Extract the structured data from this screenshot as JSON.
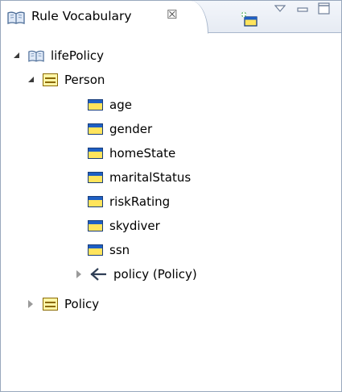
{
  "view": {
    "tab_title": "Rule Vocabulary",
    "tab_close_glyph": "☒",
    "tab_icon": "book-icon",
    "toolbar": {
      "new_icon": "new-vocabulary-icon",
      "menu_icon": "view-menu-icon",
      "minimize_icon": "minimize-icon",
      "maximize_icon": "maximize-icon"
    }
  },
  "tree": {
    "root": {
      "label": "lifePolicy",
      "icon": "book-icon",
      "expanded": true
    },
    "person": {
      "label": "Person",
      "icon": "entity-icon",
      "expanded": true,
      "attributes": [
        "age",
        "gender",
        "homeState",
        "maritalStatus",
        "riskRating",
        "skydiver",
        "ssn"
      ],
      "association": {
        "label": "policy (Policy)",
        "icon": "association-icon",
        "expanded": false
      }
    },
    "policy": {
      "label": "Policy",
      "icon": "entity-icon",
      "expanded": false
    }
  },
  "colors": {
    "frame_border": "#99a8bd",
    "entity_fill": "#fff6a8",
    "attribute_fill": "#ffe45c",
    "attribute_band": "#1e5fc4"
  }
}
